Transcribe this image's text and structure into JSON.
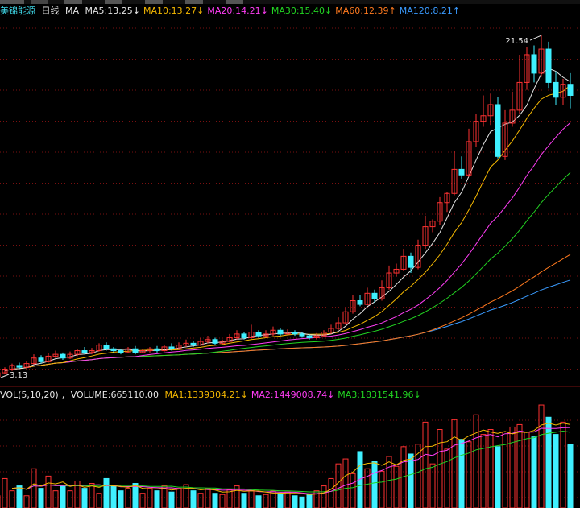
{
  "stock": {
    "name": "美锦能源",
    "period": "日线"
  },
  "price_legend": {
    "ma_label": "MA",
    "items": [
      {
        "label": "MA5:13.25",
        "arrow": "↓",
        "color": "#e6e6e6"
      },
      {
        "label": "MA10:13.27",
        "arrow": "↓",
        "color": "#f5b800"
      },
      {
        "label": "MA20:14.21",
        "arrow": "↓",
        "color": "#ff3df5"
      },
      {
        "label": "MA30:15.40",
        "arrow": "↓",
        "color": "#22d422"
      },
      {
        "label": "MA60:12.39",
        "arrow": "↑",
        "color": "#ff7a1f"
      },
      {
        "label": "MA120:8.21",
        "arrow": "↑",
        "color": "#3a9bff"
      }
    ]
  },
  "volume_legend": {
    "label": "VOL(5,10,20)",
    "volume": "VOLUME:665110.00",
    "items": [
      {
        "label": "MA1:1339304.21",
        "arrow": "↓",
        "color": "#f5b800"
      },
      {
        "label": "MA2:1449008.74",
        "arrow": "↓",
        "color": "#ff3df5"
      },
      {
        "label": "MA3:1831541.96",
        "arrow": "↓",
        "color": "#22d422"
      }
    ]
  },
  "colors": {
    "up": "#ff3232",
    "down": "#3ff0ff",
    "grid": "#7a1010",
    "background": "#000000",
    "ma5": "#e6e6e6",
    "ma10": "#f5b800",
    "ma20": "#ff3df5",
    "ma30": "#22d422",
    "ma60": "#ff7a1f",
    "ma120": "#3a9bff",
    "vol_ma5": "#f5b800",
    "vol_ma10": "#ff3df5",
    "vol_ma20": "#22d422"
  },
  "chart_data": {
    "type": "candlestick",
    "annotations": {
      "high_label": "21.54",
      "low_label": "3.13"
    },
    "price_range": [
      3.0,
      22.5
    ],
    "volume_range": [
      0,
      4300000
    ],
    "candles": [
      [
        3.1,
        3.3,
        3.5,
        3.0
      ],
      [
        3.3,
        3.5,
        3.6,
        3.25
      ],
      [
        3.5,
        3.7,
        3.8,
        3.4
      ],
      [
        3.7,
        3.6,
        3.85,
        3.5
      ],
      [
        3.6,
        3.8,
        3.95,
        3.55
      ],
      [
        3.8,
        4.1,
        4.3,
        3.75
      ],
      [
        4.1,
        3.9,
        4.25,
        3.8
      ],
      [
        3.9,
        4.2,
        4.35,
        3.85
      ],
      [
        4.2,
        4.3,
        4.5,
        4.1
      ],
      [
        4.3,
        4.1,
        4.4,
        4.0
      ],
      [
        4.1,
        4.3,
        4.45,
        4.05
      ],
      [
        4.3,
        4.5,
        4.6,
        4.2
      ],
      [
        4.5,
        4.4,
        4.7,
        4.3
      ],
      [
        4.4,
        4.5,
        4.65,
        4.3
      ],
      [
        4.5,
        4.8,
        4.9,
        4.45
      ],
      [
        4.8,
        4.6,
        4.95,
        4.5
      ],
      [
        4.6,
        4.5,
        4.7,
        4.4
      ],
      [
        4.5,
        4.4,
        4.6,
        4.3
      ],
      [
        4.4,
        4.6,
        4.7,
        4.35
      ],
      [
        4.6,
        4.4,
        4.75,
        4.3
      ],
      [
        4.4,
        4.5,
        4.6,
        4.35
      ],
      [
        4.5,
        4.6,
        4.7,
        4.4
      ],
      [
        4.6,
        4.5,
        4.75,
        4.4
      ],
      [
        4.5,
        4.7,
        4.8,
        4.45
      ],
      [
        4.7,
        4.6,
        4.9,
        4.5
      ],
      [
        4.6,
        4.8,
        4.95,
        4.55
      ],
      [
        4.8,
        4.9,
        5.1,
        4.7
      ],
      [
        4.9,
        4.8,
        5.0,
        4.7
      ],
      [
        4.8,
        5.0,
        5.2,
        4.75
      ],
      [
        5.0,
        5.1,
        5.3,
        4.9
      ],
      [
        5.1,
        4.9,
        5.2,
        4.8
      ],
      [
        4.9,
        5.0,
        5.1,
        4.85
      ],
      [
        5.0,
        5.2,
        5.4,
        4.95
      ],
      [
        5.2,
        5.4,
        5.6,
        5.1
      ],
      [
        5.4,
        5.2,
        5.5,
        5.1
      ],
      [
        5.2,
        5.5,
        5.9,
        5.15
      ],
      [
        5.5,
        5.3,
        5.6,
        5.2
      ],
      [
        5.3,
        5.4,
        5.6,
        5.2
      ],
      [
        5.4,
        5.6,
        5.8,
        5.3
      ],
      [
        5.6,
        5.4,
        5.7,
        5.3
      ],
      [
        5.4,
        5.5,
        5.65,
        5.35
      ],
      [
        5.5,
        5.4,
        5.6,
        5.3
      ],
      [
        5.4,
        5.3,
        5.5,
        5.2
      ],
      [
        5.3,
        5.2,
        5.4,
        5.1
      ],
      [
        5.2,
        5.3,
        5.45,
        5.1
      ],
      [
        5.3,
        5.5,
        5.6,
        5.25
      ],
      [
        5.5,
        5.7,
        5.9,
        5.4
      ],
      [
        5.7,
        6.0,
        6.3,
        5.6
      ],
      [
        6.0,
        6.6,
        6.8,
        5.9
      ],
      [
        6.6,
        7.2,
        7.5,
        6.5
      ],
      [
        7.2,
        7.0,
        7.5,
        6.9
      ],
      [
        7.0,
        7.6,
        7.9,
        6.95
      ],
      [
        7.6,
        7.3,
        7.8,
        7.1
      ],
      [
        7.3,
        7.9,
        8.3,
        7.2
      ],
      [
        7.9,
        8.7,
        9.1,
        7.8
      ],
      [
        8.7,
        8.9,
        9.2,
        8.5
      ],
      [
        8.9,
        9.6,
        10.0,
        8.8
      ],
      [
        9.6,
        9.0,
        9.8,
        8.7
      ],
      [
        9.0,
        10.2,
        10.5,
        8.9
      ],
      [
        10.2,
        11.2,
        11.8,
        10.0
      ],
      [
        11.2,
        11.5,
        11.6,
        10.9
      ],
      [
        11.5,
        12.5,
        12.8,
        11.3
      ],
      [
        12.5,
        13.0,
        13.1,
        12.0
      ],
      [
        13.0,
        14.3,
        15.3,
        12.9
      ],
      [
        14.3,
        14.0,
        15.0,
        13.8
      ],
      [
        14.0,
        15.8,
        16.5,
        13.9
      ],
      [
        15.8,
        16.9,
        17.3,
        15.5
      ],
      [
        16.9,
        17.2,
        18.3,
        16.6
      ],
      [
        17.2,
        17.8,
        18.4,
        16.7
      ],
      [
        17.8,
        15.0,
        18.2,
        14.9
      ],
      [
        15.0,
        16.8,
        17.5,
        14.8
      ],
      [
        16.8,
        17.5,
        18.5,
        16.6
      ],
      [
        17.5,
        19.0,
        20.5,
        17.3
      ],
      [
        19.0,
        20.5,
        20.9,
        18.6
      ],
      [
        20.5,
        19.5,
        21.0,
        19.0
      ],
      [
        19.5,
        20.8,
        21.54,
        19.3
      ],
      [
        20.8,
        19.0,
        21.2,
        18.7
      ],
      [
        19.0,
        18.2,
        19.6,
        17.8
      ],
      [
        18.2,
        18.9,
        19.2,
        17.8
      ],
      [
        18.9,
        18.3,
        19.5,
        17.6
      ]
    ],
    "volume": [
      500000,
      1200000,
      700000,
      900000,
      500000,
      1600000,
      800000,
      1300000,
      700000,
      900000,
      700000,
      1100000,
      800000,
      1000000,
      600000,
      1200000,
      900000,
      700000,
      800000,
      1000000,
      600000,
      800000,
      700000,
      900000,
      650000,
      800000,
      950000,
      700000,
      600000,
      800000,
      600000,
      550000,
      750000,
      900000,
      600000,
      700000,
      500000,
      550000,
      700000,
      600000,
      650000,
      500000,
      450000,
      550000,
      700000,
      900000,
      1200000,
      1800000,
      2000000,
      1400000,
      2300000,
      1600000,
      1900000,
      1500000,
      2100000,
      1700000,
      2500000,
      2200000,
      2600000,
      3500000,
      1800000,
      3200000,
      2400000,
      3600000,
      2800000,
      2700000,
      3800000,
      3000000,
      3200000,
      2500000,
      3100000,
      3300000,
      3400000,
      3100000,
      2900000,
      4200000,
      3700000,
      3000000,
      3500000,
      2600000
    ]
  }
}
